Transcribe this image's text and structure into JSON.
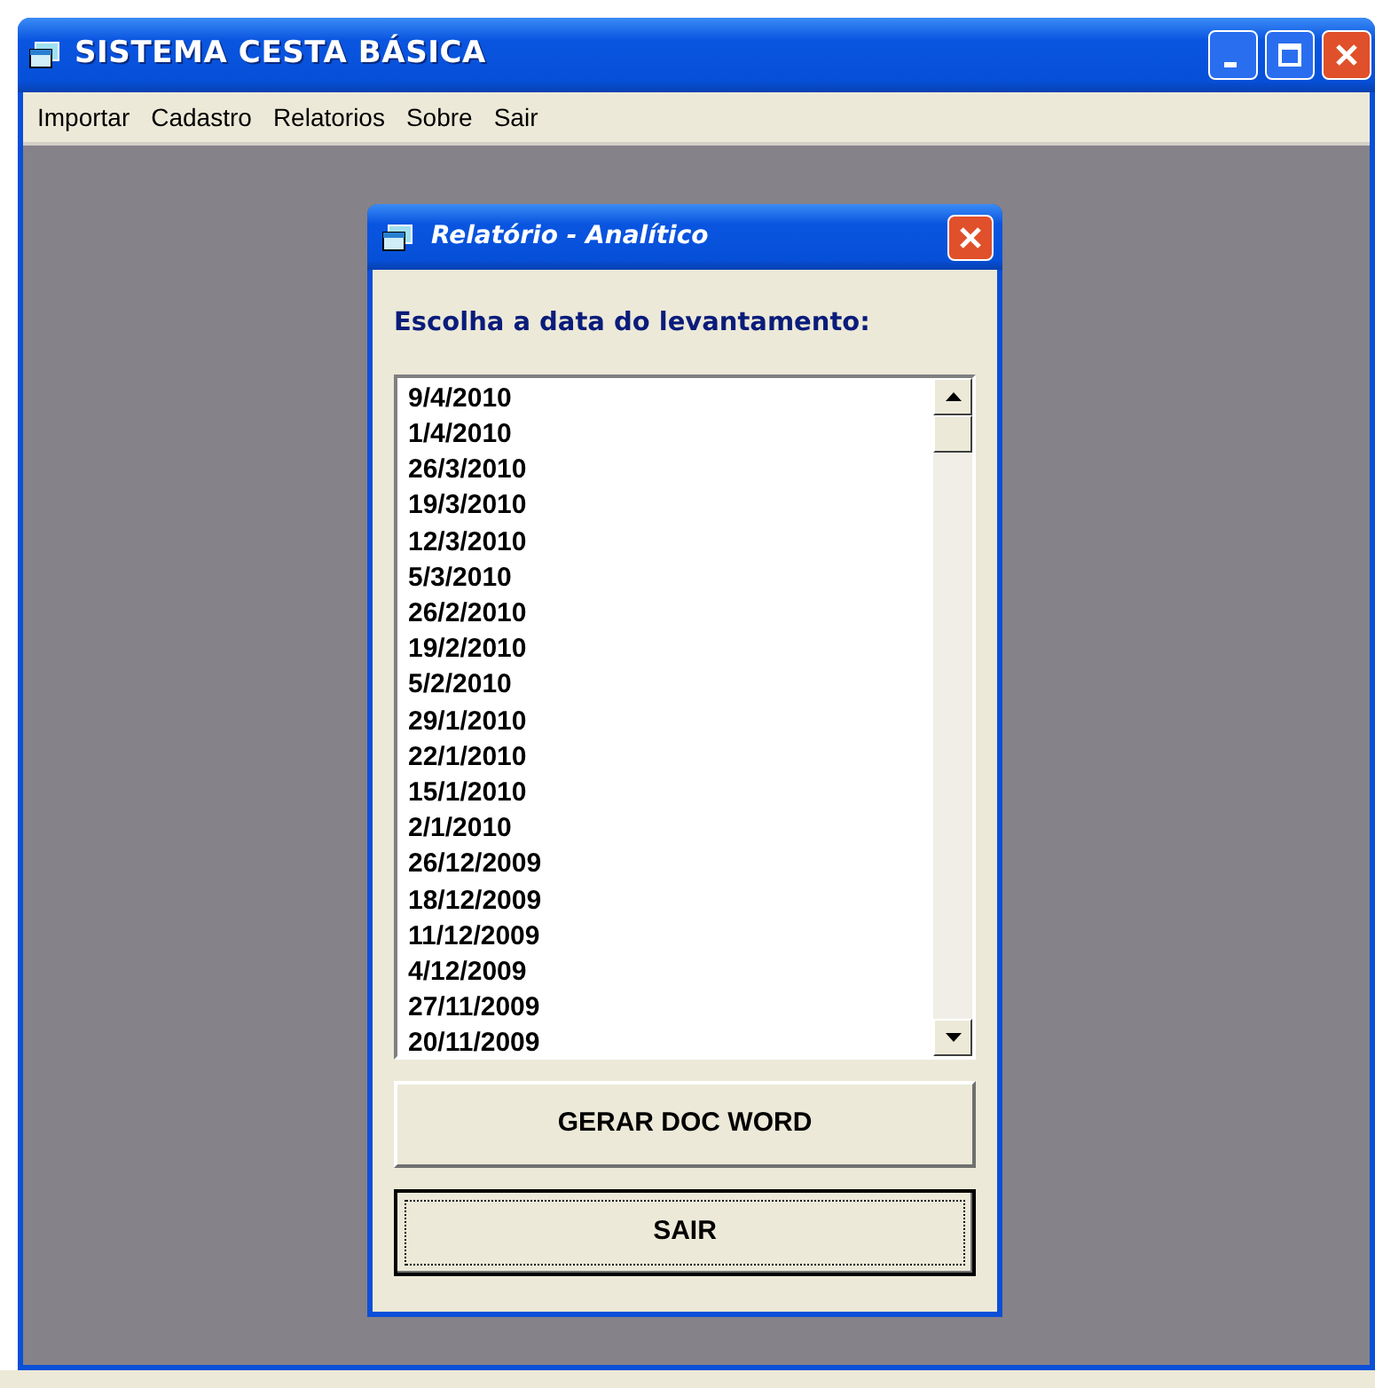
{
  "window": {
    "title": "SISTEMA CESTA BÁSICA"
  },
  "menu": [
    "Importar",
    "Cadastro",
    "Relatorios",
    "Sobre",
    "Sair"
  ],
  "dialog": {
    "title": "Relatório - Analítico",
    "prompt": "Escolha a data do levantamento:",
    "dates": [
      "9/4/2010",
      "1/4/2010",
      "26/3/2010",
      "19/3/2010",
      "12/3/2010",
      "5/3/2010",
      "26/2/2010",
      "19/2/2010",
      "5/2/2010",
      "29/1/2010",
      "22/1/2010",
      "15/1/2010",
      "2/1/2010",
      "26/12/2009",
      "18/12/2009",
      "11/12/2009",
      "4/12/2009",
      "27/11/2009",
      "20/11/2009"
    ],
    "buttons": [
      {
        "label": "GERAR DOC WORD",
        "focused": false
      },
      {
        "label": "SAIR",
        "focused": true
      }
    ]
  }
}
